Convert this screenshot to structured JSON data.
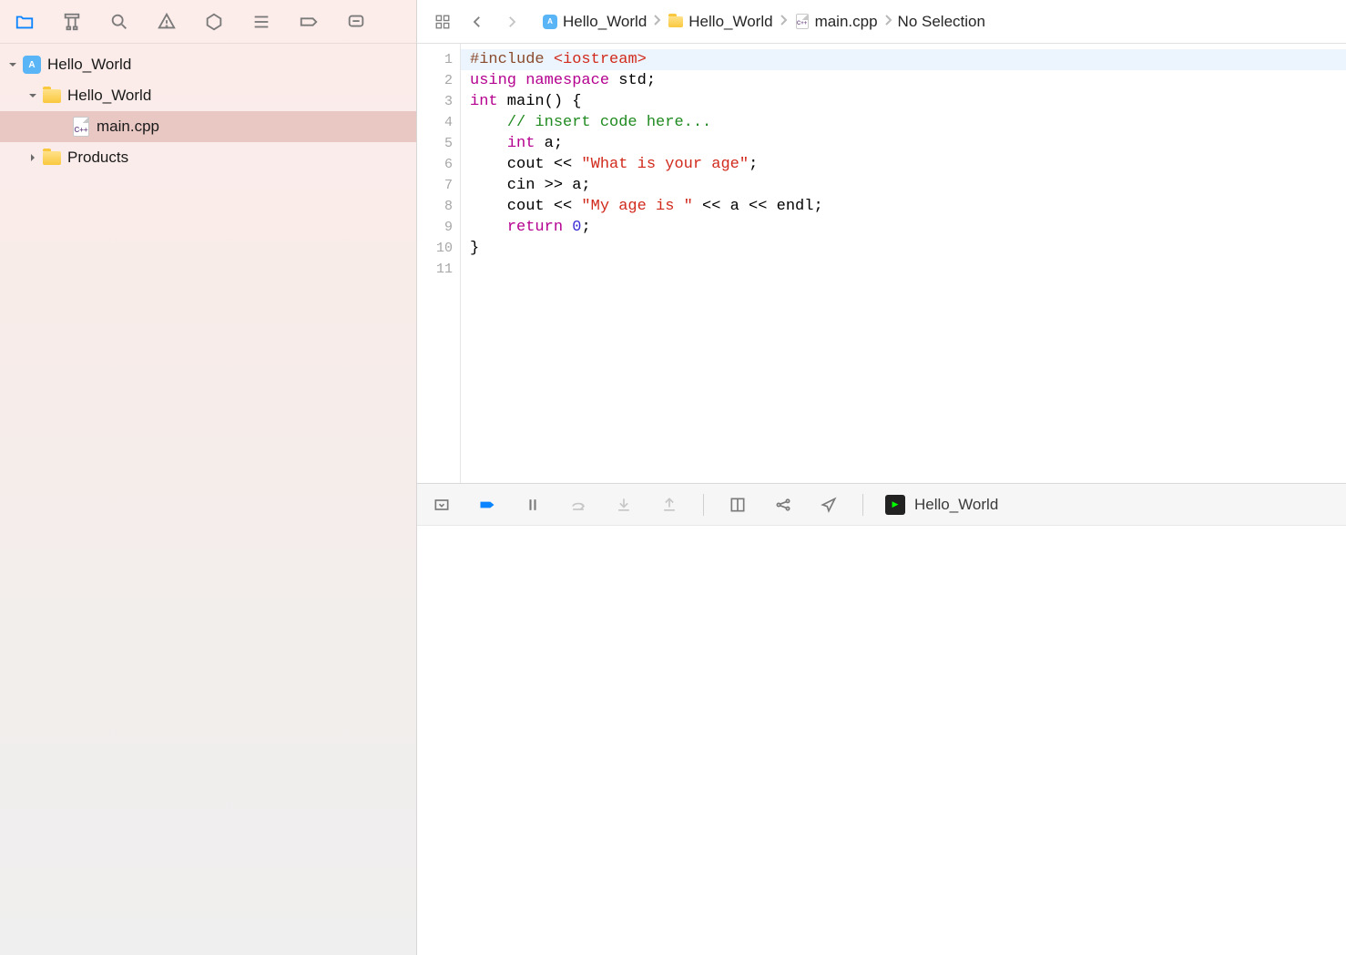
{
  "sidebar": {
    "items": [
      {
        "label": "Hello_World",
        "kind": "project",
        "expanded": true,
        "depth": 0
      },
      {
        "label": "Hello_World",
        "kind": "folder",
        "expanded": true,
        "depth": 1
      },
      {
        "label": "main.cpp",
        "kind": "cpp",
        "depth": 2,
        "selected": true
      },
      {
        "label": "Products",
        "kind": "folder",
        "expanded": false,
        "depth": 1
      }
    ]
  },
  "breadcrumb": {
    "segments": [
      {
        "label": "Hello_World",
        "icon": "project"
      },
      {
        "label": "Hello_World",
        "icon": "folder"
      },
      {
        "label": "main.cpp",
        "icon": "cpp"
      },
      {
        "label": "No Selection",
        "icon": ""
      }
    ]
  },
  "code": {
    "lines": [
      {
        "n": "1",
        "html": "<span class='tk-include'>#include</span> <span class='tk-header'>&lt;iostream&gt;</span>"
      },
      {
        "n": "2",
        "html": "<span class='tk-keyword'>using</span> <span class='tk-keyword'>namespace</span> std;"
      },
      {
        "n": "3",
        "html": "<span class='tk-type'>int</span> main() {"
      },
      {
        "n": "4",
        "html": "    <span class='tk-comment'>// insert code here...</span>"
      },
      {
        "n": "5",
        "html": "    <span class='tk-type'>int</span> a;"
      },
      {
        "n": "6",
        "html": "    cout &lt;&lt; <span class='tk-string'>\"What is your age\"</span>;"
      },
      {
        "n": "7",
        "html": "    cin &gt;&gt; a;"
      },
      {
        "n": "8",
        "html": "    cout &lt;&lt; <span class='tk-string'>\"My age is \"</span> &lt;&lt; a &lt;&lt; endl;"
      },
      {
        "n": "9",
        "html": "    <span class='tk-keyword'>return</span> <span class='tk-number'>0</span>;"
      },
      {
        "n": "10",
        "html": "}"
      },
      {
        "n": "11",
        "html": ""
      }
    ]
  },
  "debug": {
    "app": "Hello_World"
  },
  "icons": {
    "cpp_label": "C++"
  }
}
